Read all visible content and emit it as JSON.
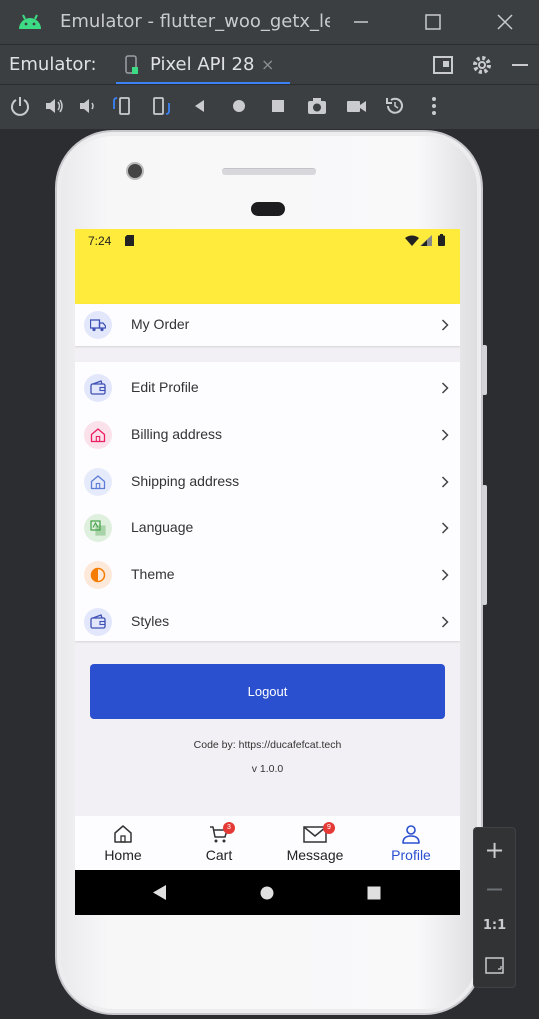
{
  "window": {
    "title": "Emulator - flutter_woo_getx_le",
    "minimize_icon": "minimize-icon",
    "maximize_icon": "maximize-icon",
    "close_icon": "close-icon"
  },
  "tabbar": {
    "label": "Emulator:",
    "tab_name": "Pixel API 28",
    "tab_close": "×"
  },
  "phone_status": {
    "time": "7:24"
  },
  "menu": {
    "order": {
      "label": "My Order",
      "icon": "truck-icon",
      "tint": "#e3e7fb",
      "color": "#3f51b5"
    },
    "items": [
      {
        "label": "Edit Profile",
        "icon": "wallet-icon",
        "tint": "#e3e7fb",
        "color": "#3f51b5"
      },
      {
        "label": "Billing address",
        "icon": "home-icon",
        "tint": "#fbe1ea",
        "color": "#e91e63"
      },
      {
        "label": "Shipping address",
        "icon": "home-icon",
        "tint": "#e6ebfb",
        "color": "#5c7cd6"
      },
      {
        "label": "Language",
        "icon": "translate-icon",
        "tint": "#dff0df",
        "color": "#43a047"
      },
      {
        "label": "Theme",
        "icon": "contrast-icon",
        "tint": "#fde9da",
        "color": "#f57c00"
      },
      {
        "label": "Styles",
        "icon": "wallet-icon",
        "tint": "#e3e7fb",
        "color": "#3f51b5"
      }
    ]
  },
  "logout_label": "Logout",
  "credit": "Code by: https://ducafefcat.tech",
  "version": "v 1.0.0",
  "bottom_nav": {
    "home": {
      "label": "Home"
    },
    "cart": {
      "label": "Cart",
      "badge": "3"
    },
    "message": {
      "label": "Message",
      "badge": "9"
    },
    "profile": {
      "label": "Profile",
      "active_color": "#2b50cf"
    }
  },
  "zoom": {
    "plus": "+",
    "minus": "−",
    "one_to_one": "1:1"
  }
}
